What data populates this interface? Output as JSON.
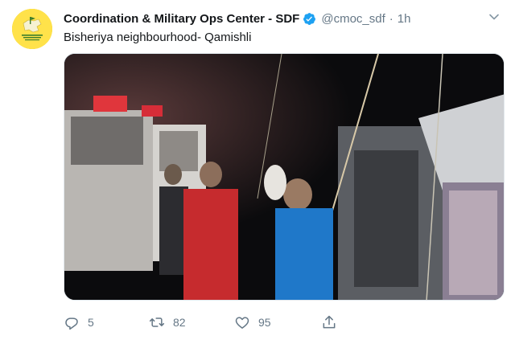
{
  "tweet": {
    "author_name": "Coordination & Military Ops Center - SDF",
    "handle": "@cmoc_sdf",
    "separator": "·",
    "time": "1h",
    "text": "Bisheriya neighbourhood- Qamishli",
    "verified": true
  },
  "actions": {
    "replies": "5",
    "retweets": "82",
    "likes": "95"
  },
  "icons": {
    "reply": "reply-icon",
    "retweet": "retweet-icon",
    "like": "heart-icon",
    "share": "share-icon",
    "more": "chevron-down-icon",
    "verified": "verified-badge-icon"
  },
  "colors": {
    "accent": "#1da1f2",
    "muted": "#657786",
    "avatar_bg": "#ffe24a"
  }
}
